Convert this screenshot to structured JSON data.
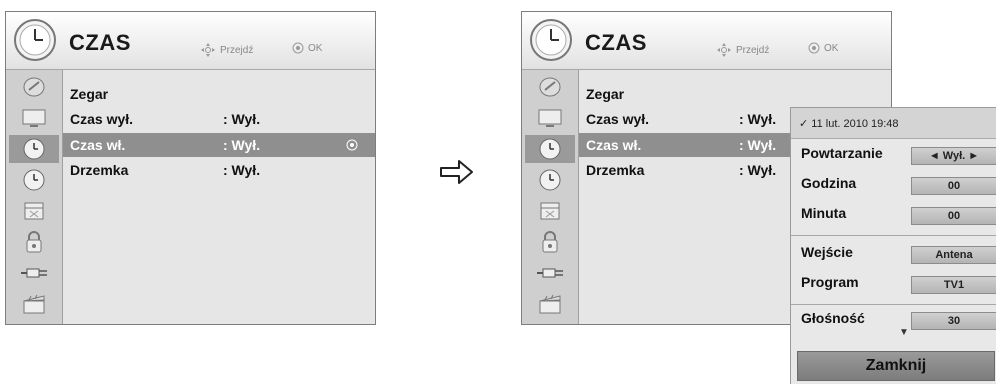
{
  "menu": {
    "title": "CZAS",
    "nav_hint": "Przejdź",
    "ok_hint": "OK",
    "rows": [
      {
        "label": "Zegar",
        "value": ""
      },
      {
        "label": "Czas wył.",
        "value": ": Wył."
      },
      {
        "label": "Czas wł.",
        "value": ": Wył."
      },
      {
        "label": "Drzemka",
        "value": ": Wył."
      }
    ],
    "selected_row": 2,
    "sidebar_icons": [
      "satellite-icon",
      "tv-screen-icon",
      "clock-icon",
      "clock-icon",
      "calendar-icon",
      "lock-icon",
      "input-plug-icon",
      "clapperboard-icon"
    ],
    "active_icon": 2
  },
  "popup": {
    "date": "11 lut. 2010 19:48",
    "rows": [
      {
        "label": "Powtarzanie",
        "value": "◄ Wył. ►"
      },
      {
        "label": "Godzina",
        "value": "00"
      },
      {
        "label": "Minuta",
        "value": "00"
      },
      {
        "label": "Wejście",
        "value": "Antena"
      },
      {
        "label": "Program",
        "value": "TV1"
      },
      {
        "label": "Głośność",
        "value": "30"
      }
    ],
    "close_label": "Zamknij"
  },
  "colors": {
    "selected_row": "#8f8f8f",
    "panel_bg": "#e6e6e6",
    "icon_column": "#cfcfcf"
  }
}
